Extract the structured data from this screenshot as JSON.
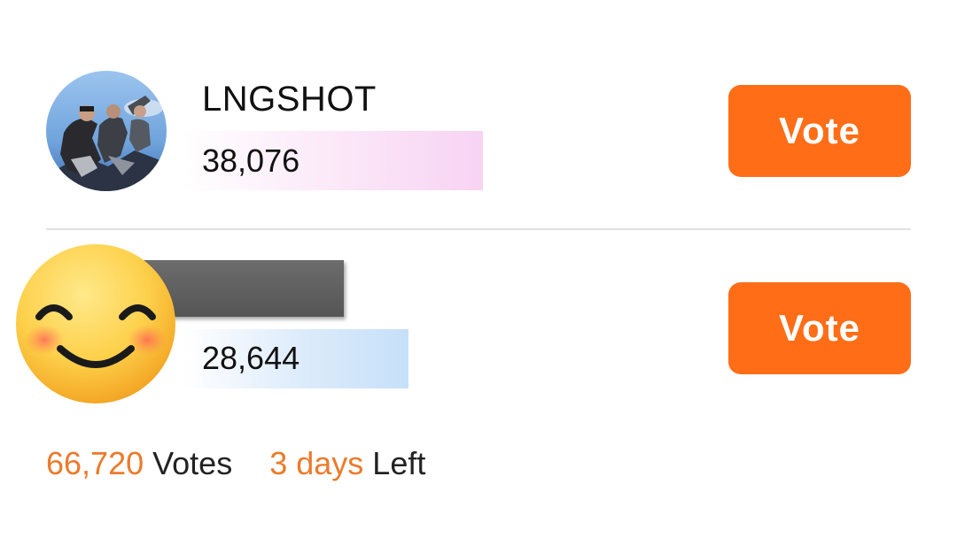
{
  "candidates": [
    {
      "name": "LNGSHOT",
      "votes": "38,076",
      "vote_share": 0.571,
      "bar_color": "#f7d3f3",
      "avatar": "group-photo-avatar",
      "button_label": "Vote"
    },
    {
      "name": "",
      "votes": "28,644",
      "vote_share": 0.429,
      "bar_color": "#c6e0f9",
      "avatar": "smiling-face-emoji",
      "button_label": "Vote"
    }
  ],
  "footer": {
    "total_votes": "66,720",
    "votes_label": "Votes",
    "time_left": "3 days",
    "left_label": "Left"
  },
  "colors": {
    "accent": "#ff6d17",
    "accent_text": "#ec7a2a",
    "divider": "#e1e1e1"
  }
}
